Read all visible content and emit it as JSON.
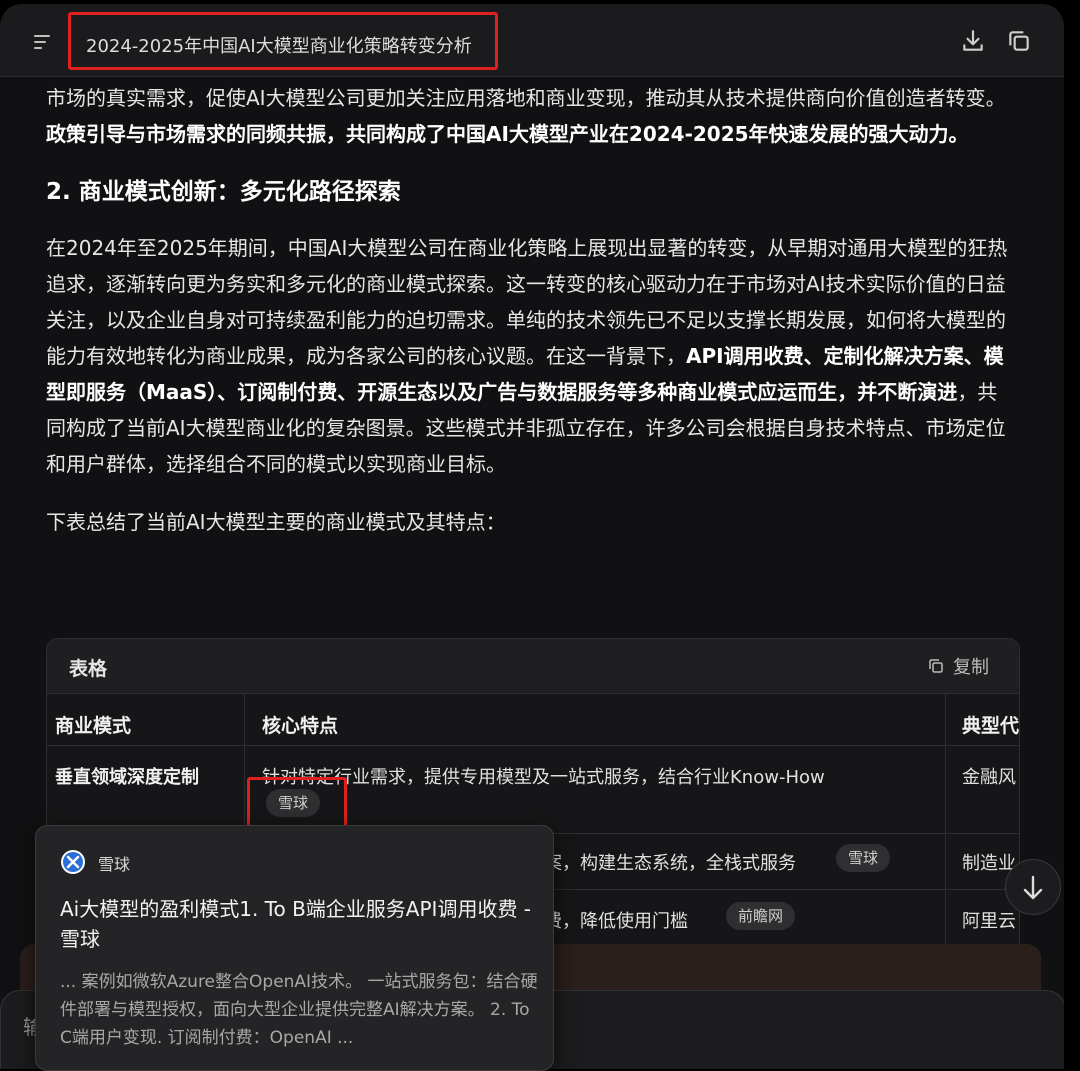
{
  "header": {
    "title": "2024-2025年中国AI大模型商业化策略转变分析"
  },
  "content": {
    "p1_text": "市场的真实需求，促使AI大模型公司更加关注应用落地和商业变现，推动其从技术提供商向价值创造者转变。",
    "p1_bold": "政策引导与市场需求的同频共振，共同构成了中国AI大模型产业在2024-2025年快速发展的强大动力。",
    "h2": "2. 商业模式创新：多元化路径探索",
    "p2_start": "在2024年至2025年期间，中国AI大模型公司在商业化策略上展现出显著的转变，从早期对通用大模型的狂热追求，逐渐转向更为务实和多元化的商业模式探索。这一转变的核心驱动力在于市场对AI技术实际价值的日益关注，以及企业自身对可持续盈利能力的迫切需求。单纯的技术领先已不足以支撑长期发展，如何将大模型的能力有效地转化为商业成果，成为各家公司的核心议题。在这一背景下，",
    "p2_bold": "API调用收费、定制化解决方案、模型即服务（MaaS）、订阅制付费、开源生态以及广告与数据服务等多种商业模式应运而生，并不断演进",
    "p2_end": "，共同构成了当前AI大模型商业化的复杂图景。这些模式并非孤立存在，许多公司会根据自身技术特点、市场定位和用户群体，选择组合不同的模式以实现商业目标。",
    "p3": "下表总结了当前AI大模型主要的商业模式及其特点："
  },
  "table": {
    "title": "表格",
    "copy_label": "复制",
    "headers": [
      "商业模式",
      "核心特点",
      "典型代"
    ],
    "rows": [
      {
        "model": "垂直领域深度定制",
        "feature": "针对特定行业需求，提供专用模型及一站式服务，结合行业Know-How",
        "chip": "雪球",
        "example": "金融风"
      },
      {
        "model": "",
        "feature": "案，构建生态系统，全栈式服务",
        "chip": "雪球",
        "example": "制造业"
      },
      {
        "model": "",
        "feature": "费，降低使用门槛",
        "chip": "前瞻网",
        "example": "阿里云"
      }
    ]
  },
  "popup": {
    "source": "雪球",
    "title": "Ai大模型的盈利模式1. To B端企业服务API调用收费 - 雪球",
    "snippet": "... 案例如微软Azure整合OpenAI技术。 一站式服务包：结合硬件部署与模型授权，面向大型企业提供完整AI解决方案。 2. To C端用户变现. 订阅制付费：OpenAI ..."
  },
  "input": {
    "placeholder": "输"
  },
  "colors": {
    "highlight": "#e0201e",
    "background": "#111113"
  }
}
